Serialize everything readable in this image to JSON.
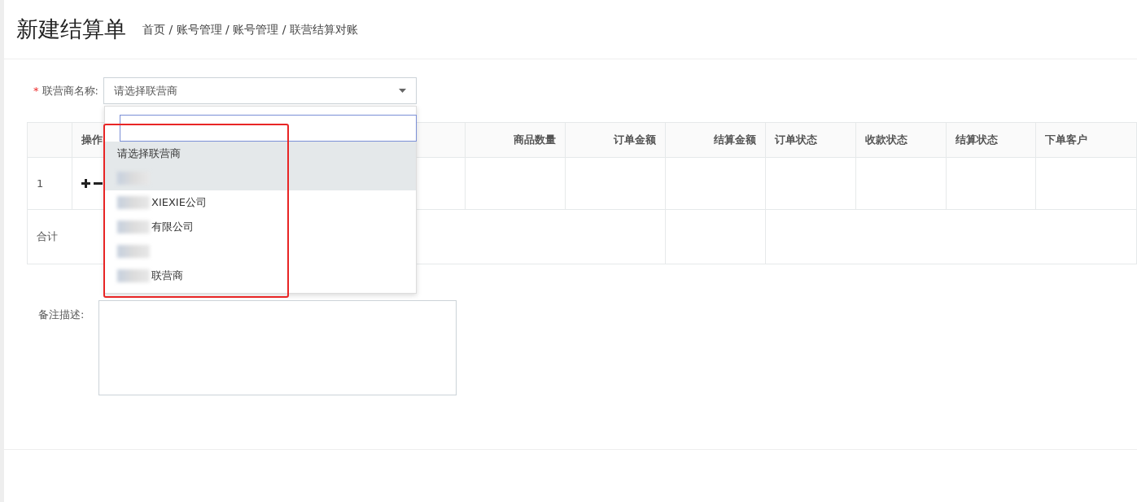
{
  "page_title": "新建结算单",
  "breadcrumb": "首页 / 账号管理 / 账号管理 / 联营结算对账",
  "partner_field": {
    "required_mark": "*",
    "label": "联营商名称:",
    "value": "请选择联营商"
  },
  "dropdown": {
    "options": [
      {
        "text": "请选择联营商",
        "highlighted": true,
        "kind": "plain"
      },
      {
        "highlighted": true,
        "kind": "redacted"
      },
      {
        "text": "XIEXIE公司",
        "highlighted": false,
        "kind": "redacted"
      },
      {
        "text": "有限公司",
        "highlighted": false,
        "kind": "redacted"
      },
      {
        "highlighted": false,
        "kind": "redacted"
      },
      {
        "text": "联营商",
        "highlighted": false,
        "kind": "redacted"
      }
    ]
  },
  "table": {
    "columns": [
      {
        "kind": "index"
      },
      {
        "label": "操作",
        "kind": "text"
      },
      {
        "label": "商品数量",
        "kind": "amount"
      },
      {
        "label": "订单金额",
        "kind": "amount"
      },
      {
        "label": "结算金额",
        "kind": "amount"
      },
      {
        "label": "订单状态",
        "kind": "text"
      },
      {
        "label": "收款状态",
        "kind": "text"
      },
      {
        "label": "结算状态",
        "kind": "text"
      },
      {
        "label": "下单客户",
        "kind": "text"
      }
    ],
    "rows": [
      {
        "index": "1"
      }
    ],
    "total_label": "合计"
  },
  "remark": {
    "label": "备注描述:"
  }
}
